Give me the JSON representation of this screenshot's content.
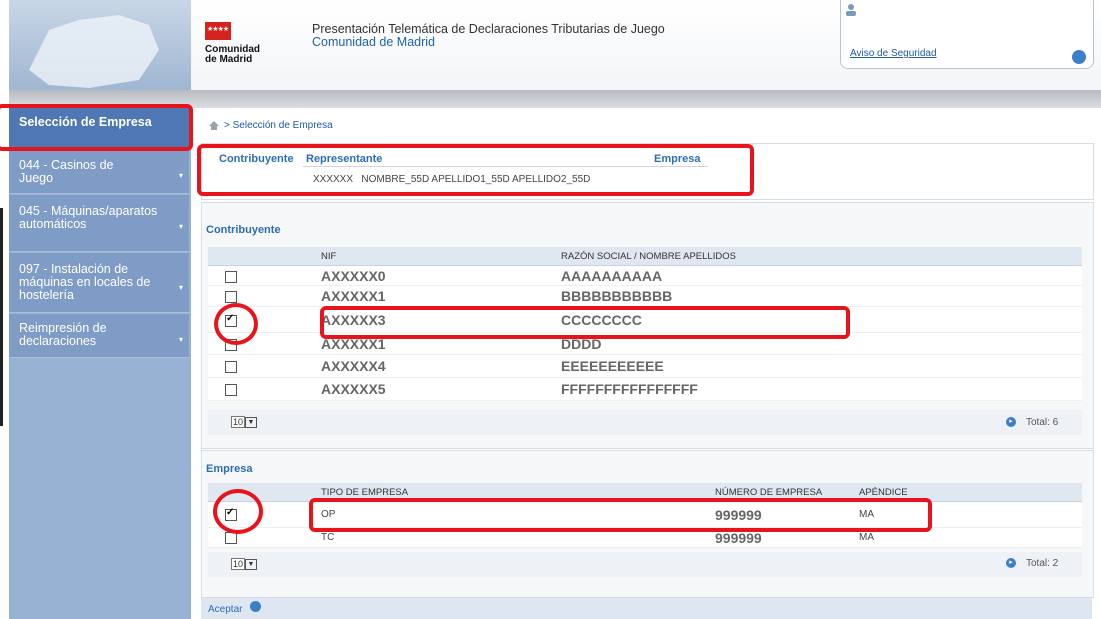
{
  "header": {
    "org_line1": "Comunidad",
    "org_line2": "de Madrid",
    "title_line1": "Presentación Telemática de Declaraciones Tributarias de Juego",
    "title_line2": "Comunidad de Madrid",
    "security_link": "Aviso de Seguridad"
  },
  "sidebar": {
    "items": [
      {
        "label": "Selección de Empresa"
      },
      {
        "label": "044 - Casinos de Juego"
      },
      {
        "label": "045 - Máquinas/aparatos automáticos"
      },
      {
        "label": "097 - Instalación de máquinas en locales de hostelería"
      },
      {
        "label": "Reimpresión de declaraciones"
      }
    ]
  },
  "breadcrumb": {
    "separator": ">",
    "current": "Selección de Empresa"
  },
  "representante": {
    "headers": {
      "contribuyente": "Contribuyente",
      "representante": "Representante",
      "empresa": "Empresa"
    },
    "nif": "XXXXXX",
    "nombre": "NOMBRE_55D APELLIDO1_55D APELLIDO2_55D"
  },
  "contribuyente": {
    "title": "Contribuyente",
    "columns": [
      "NIF",
      "RAZÓN SOCIAL / NOMBRE APELLIDOS"
    ],
    "rows": [
      {
        "checked": false,
        "nif": "AXXXXX0",
        "name": "AAAAAAAAAA"
      },
      {
        "checked": false,
        "nif": "AXXXXX1",
        "name": "BBBBBBBBBBB"
      },
      {
        "checked": true,
        "nif": "AXXXXX3",
        "name": "CCCCCCCC"
      },
      {
        "checked": false,
        "nif": "AXXXXX1",
        "name": "DDDD"
      },
      {
        "checked": false,
        "nif": "AXXXXX4",
        "name": "EEEEEEEEEEE"
      },
      {
        "checked": false,
        "nif": "AXXXXX5",
        "name": "FFFFFFFFFFFFFFFF"
      }
    ],
    "page_size": "10",
    "total": "Total: 6"
  },
  "empresa": {
    "title": "Empresa",
    "columns": [
      "TIPO DE EMPRESA",
      "NÚMERO DE EMPRESA",
      "APÉNDICE"
    ],
    "rows": [
      {
        "checked": true,
        "tipo": "OP",
        "numero": "999999",
        "apendice": "MA"
      },
      {
        "checked": false,
        "tipo": "TC",
        "numero": "999999",
        "apendice": "MA"
      }
    ],
    "page_size": "10",
    "total": "Total: 2"
  },
  "actions": {
    "accept": "Aceptar"
  },
  "colors": {
    "accent": "#2e6db4",
    "sidebar": "#7f9cc6",
    "sidebar_selected": "#4f77b4",
    "annotation": "#e8141b"
  }
}
